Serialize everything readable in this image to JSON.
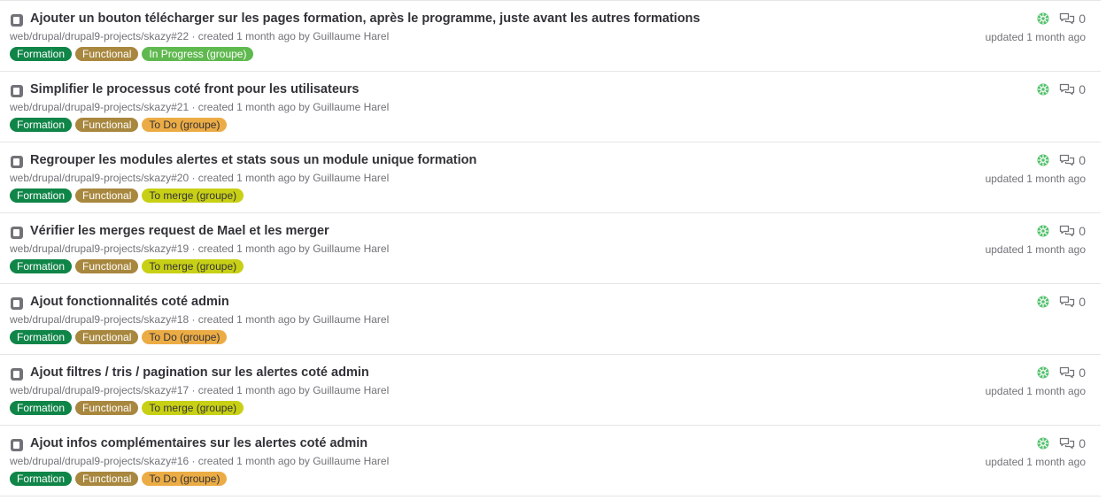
{
  "colors": {
    "formation": "#108548",
    "functional": "#a8873e",
    "in_progress": "#5fb94f",
    "to_do": "#ecac45",
    "to_merge": "#c8d015",
    "status_icon": "#52c16b"
  },
  "issues": [
    {
      "title": "Ajouter un bouton télécharger sur les pages formation, après le programme, juste avant les autres formations",
      "ref": "web/drupal/drupal9-projects/skazy#22",
      "created_text": " · created 1 month ago by ",
      "author": "Guillaume Harel",
      "labels": [
        {
          "text": "Formation",
          "color": "#108548",
          "dark": false
        },
        {
          "text": "Functional",
          "color": "#a8873e",
          "dark": false
        },
        {
          "text": "In Progress (groupe)",
          "color": "#5fb94f",
          "dark": false
        }
      ],
      "comments": "0",
      "updated": "updated 1 month ago"
    },
    {
      "title": "Simplifier le processus coté front pour les utilisateurs",
      "ref": "web/drupal/drupal9-projects/skazy#21",
      "created_text": " · created 1 month ago by ",
      "author": "Guillaume Harel",
      "labels": [
        {
          "text": "Formation",
          "color": "#108548",
          "dark": false
        },
        {
          "text": "Functional",
          "color": "#a8873e",
          "dark": false
        },
        {
          "text": "To Do (groupe)",
          "color": "#ecac45",
          "dark": true
        }
      ],
      "comments": "0",
      "updated": ""
    },
    {
      "title": "Regrouper les modules alertes et stats sous un module unique formation",
      "ref": "web/drupal/drupal9-projects/skazy#20",
      "created_text": " · created 1 month ago by ",
      "author": "Guillaume Harel",
      "labels": [
        {
          "text": "Formation",
          "color": "#108548",
          "dark": false
        },
        {
          "text": "Functional",
          "color": "#a8873e",
          "dark": false
        },
        {
          "text": "To merge (groupe)",
          "color": "#c8d015",
          "dark": true
        }
      ],
      "comments": "0",
      "updated": "updated 1 month ago"
    },
    {
      "title": "Vérifier les merges request de Mael et les merger",
      "ref": "web/drupal/drupal9-projects/skazy#19",
      "created_text": " · created 1 month ago by ",
      "author": "Guillaume Harel",
      "labels": [
        {
          "text": "Formation",
          "color": "#108548",
          "dark": false
        },
        {
          "text": "Functional",
          "color": "#a8873e",
          "dark": false
        },
        {
          "text": "To merge (groupe)",
          "color": "#c8d015",
          "dark": true
        }
      ],
      "comments": "0",
      "updated": "updated 1 month ago"
    },
    {
      "title": "Ajout fonctionnalités coté admin",
      "ref": "web/drupal/drupal9-projects/skazy#18",
      "created_text": " · created 1 month ago by ",
      "author": "Guillaume Harel",
      "labels": [
        {
          "text": "Formation",
          "color": "#108548",
          "dark": false
        },
        {
          "text": "Functional",
          "color": "#a8873e",
          "dark": false
        },
        {
          "text": "To Do (groupe)",
          "color": "#ecac45",
          "dark": true
        }
      ],
      "comments": "0",
      "updated": ""
    },
    {
      "title": "Ajout filtres / tris / pagination sur les alertes coté admin",
      "ref": "web/drupal/drupal9-projects/skazy#17",
      "created_text": " · created 1 month ago by ",
      "author": "Guillaume Harel",
      "labels": [
        {
          "text": "Formation",
          "color": "#108548",
          "dark": false
        },
        {
          "text": "Functional",
          "color": "#a8873e",
          "dark": false
        },
        {
          "text": "To merge (groupe)",
          "color": "#c8d015",
          "dark": true
        }
      ],
      "comments": "0",
      "updated": "updated 1 month ago"
    },
    {
      "title": "Ajout infos complémentaires sur les alertes coté admin",
      "ref": "web/drupal/drupal9-projects/skazy#16",
      "created_text": " · created 1 month ago by ",
      "author": "Guillaume Harel",
      "labels": [
        {
          "text": "Formation",
          "color": "#108548",
          "dark": false
        },
        {
          "text": "Functional",
          "color": "#a8873e",
          "dark": false
        },
        {
          "text": "To Do (groupe)",
          "color": "#ecac45",
          "dark": true
        }
      ],
      "comments": "0",
      "updated": "updated 1 month ago"
    }
  ]
}
